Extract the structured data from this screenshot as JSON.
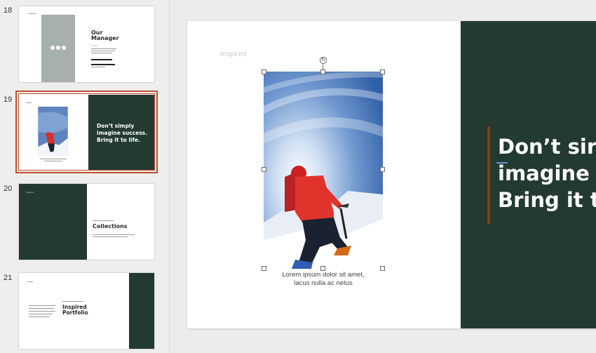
{
  "slides": [
    {
      "number": "18",
      "title_line1": "Our",
      "title_line2": "Manager",
      "subtitle": "Homes",
      "placeholder_icon": "people-icon"
    },
    {
      "number": "19",
      "headline_line1": "Don’t simply",
      "headline_line2": "imagine success.",
      "headline_line3": "Bring it to life.",
      "caption": "Lorem ipsum dolor sit amet, lacus nulla ac netus"
    },
    {
      "number": "20",
      "title": "Collections",
      "label": "Inspired"
    },
    {
      "number": "21",
      "title_line1": "Inspired",
      "title_line2": "Portfolio"
    }
  ],
  "main_slide": {
    "label": "Inspired",
    "headline_line1": "Don’t sir",
    "headline_line2": "imagine",
    "headline_line3": "Bring it to",
    "caption_line1": "Lorem ipsum dolor sit amet,",
    "caption_line2": "lacus nulla ac netus",
    "rotate_icon": "rotate-icon"
  },
  "colors": {
    "accent_green": "#223a2f",
    "selection_border": "#c1502e",
    "accent_bar": "#8a3a17"
  }
}
